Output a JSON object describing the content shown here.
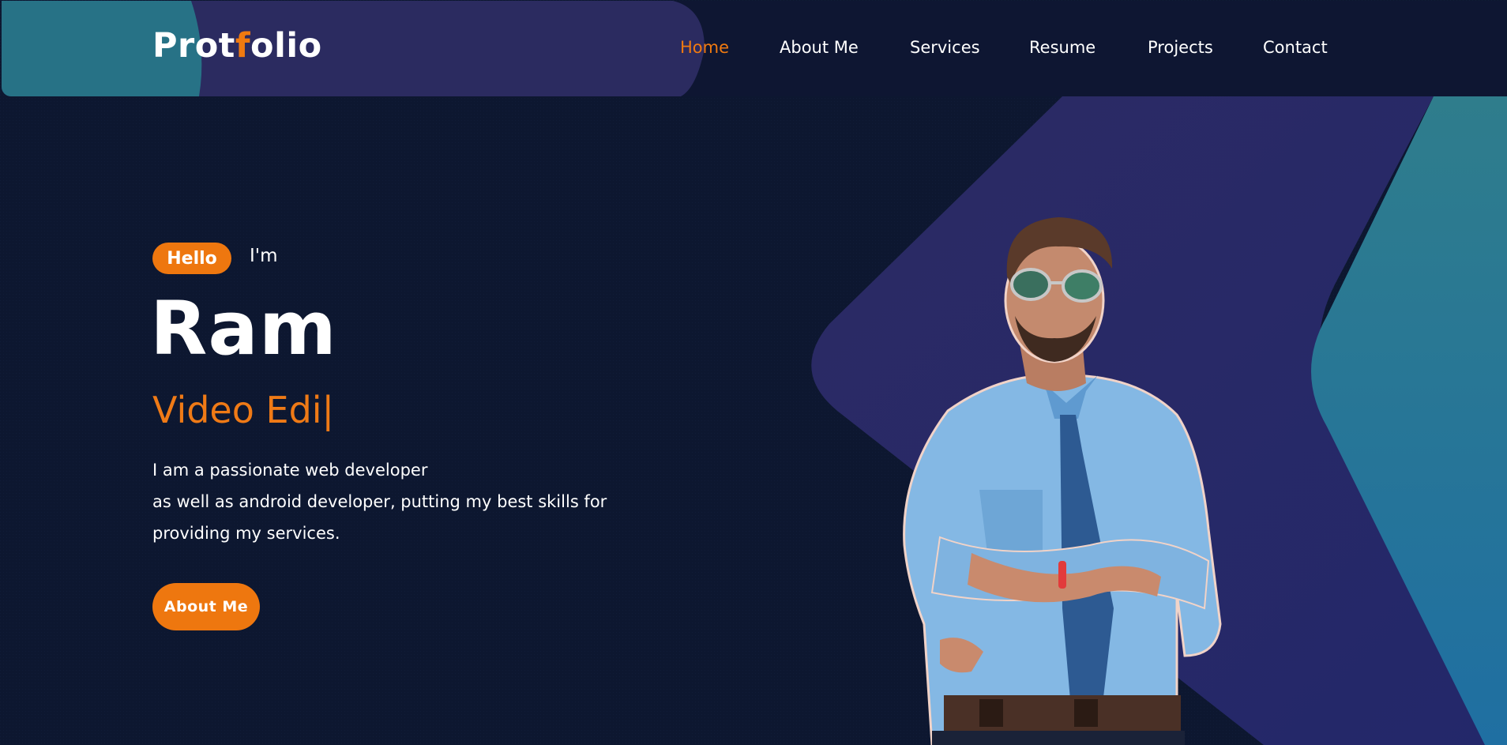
{
  "header": {
    "logo": {
      "part1": "Prot",
      "accent": "f",
      "part2": "olio"
    },
    "nav": [
      {
        "label": "Home",
        "active": true
      },
      {
        "label": "About Me",
        "active": false
      },
      {
        "label": "Services",
        "active": false
      },
      {
        "label": "Resume",
        "active": false
      },
      {
        "label": "Projects",
        "active": false
      },
      {
        "label": "Contact",
        "active": false
      }
    ]
  },
  "hero": {
    "badge": "Hello",
    "intro": "I'm",
    "name": "Ram",
    "role_typed": "Video Edi",
    "caret": "|",
    "description": [
      "I am a passionate web developer",
      "as well as android developer, putting my best skills for",
      "providing my services."
    ],
    "cta_label": "About Me",
    "portrait_icon": "person-portrait"
  },
  "colors": {
    "background": "#0d1730",
    "accent": "#ef7a10",
    "purple_shape": "#2b2d66",
    "teal_shape": "#2a7b90",
    "text": "#ffffff"
  }
}
